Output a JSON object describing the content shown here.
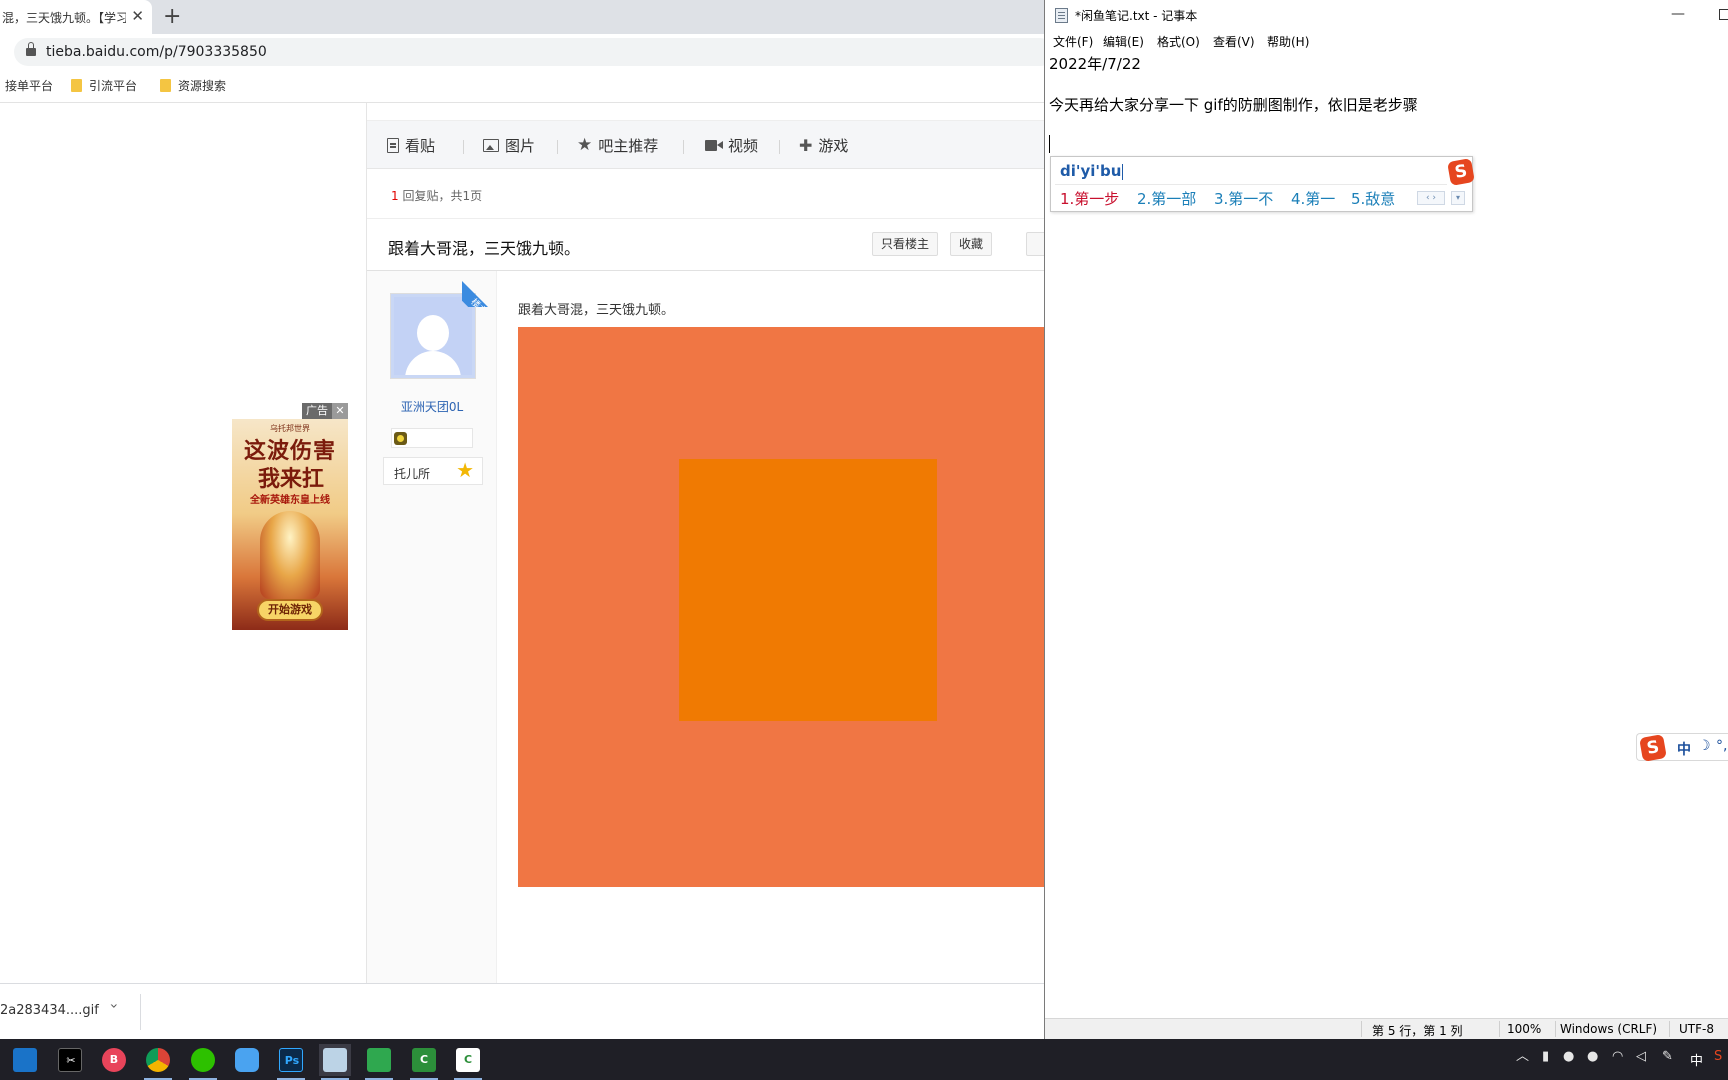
{
  "browser": {
    "tab": {
      "title": "混，三天饿九顿。【学习",
      "close_glyph": "✕"
    },
    "new_tab_glyph": "+",
    "url": "tieba.baidu.com/p/7903335850",
    "bookmarks": [
      {
        "label": "接单平台"
      },
      {
        "label": "引流平台"
      },
      {
        "label": "资源搜索"
      }
    ],
    "nav": {
      "kantie": "看贴",
      "tupian": "图片",
      "bazhu": "吧主推荐",
      "shipin": "视频",
      "youxi": "游戏"
    },
    "reply_count": {
      "num": "1",
      "text": "回复贴，共1页"
    },
    "thread_title": "跟着大哥混，三天饿九顿。",
    "buttons": {
      "only_op": "只看楼主",
      "favorite": "收藏"
    },
    "post": {
      "ribbon": "楼主",
      "author_name": "亚洲天团0L",
      "tag": "托儿所",
      "text": "跟着大哥混，三天饿九顿。",
      "gif_colors": {
        "outer": "#f07644",
        "inner": "#f07a02"
      }
    },
    "ad": {
      "tag": "广告",
      "close": "✕",
      "brand": "乌托邦世界",
      "line1": "这波伤害",
      "line2": "我来扛",
      "sub": "全新英雄东皇上线",
      "button": "开始游戏"
    },
    "download": {
      "filename": "2a283434....gif",
      "chevron": "‹"
    }
  },
  "notepad": {
    "title": "*闲鱼笔记.txt - 记事本",
    "menu": [
      "文件(F)",
      "编辑(E)",
      "格式(O)",
      "查看(V)",
      "帮助(H)"
    ],
    "lines": [
      "2022年/7/22",
      "今天再给大家分享一下  gif的防删图制作，依旧是老步骤"
    ],
    "ime": {
      "input": "di'yi'bu",
      "logo": "S",
      "candidates": [
        "1.第一步",
        "2.第一部",
        "3.第一不",
        "4.第一",
        "5.敌意"
      ],
      "pager": "‹ ›",
      "more": "▾"
    },
    "status": {
      "position": "第 5 行，第 1 列",
      "zoom": "100%",
      "eol": "Windows (CRLF)",
      "encoding": "UTF-8"
    }
  },
  "ime_floating": {
    "logo": "S",
    "lang": "中",
    "moon": "☽",
    "punc": "°,"
  },
  "taskbar": {
    "apps": [
      {
        "name": "mail-icon",
        "text": "",
        "color": "#1a73c8"
      },
      {
        "name": "capcut-icon",
        "text": "✂",
        "color": "#000000"
      },
      {
        "name": "bilibili-icon",
        "text": "B",
        "color": "#e8445a"
      },
      {
        "name": "chrome-icon",
        "text": "",
        "color": "#db4437"
      },
      {
        "name": "wechat-icon",
        "text": "",
        "color": "#2dc100"
      },
      {
        "name": "baidu-netdisk-icon",
        "text": "",
        "color": "#4aa3f0"
      },
      {
        "name": "photoshop-icon",
        "text": "Ps",
        "color": "#0b2a4a"
      },
      {
        "name": "notepad-icon",
        "text": "",
        "color": "#bcd3e6"
      },
      {
        "name": "green-app-icon",
        "text": "",
        "color": "#2fa84f"
      },
      {
        "name": "camtasia-icon",
        "text": "C",
        "color": "#2c8f3a"
      },
      {
        "name": "camtasia-recorder-icon",
        "text": "C",
        "color": "#2c8f3a"
      }
    ],
    "tray_lang": "中"
  }
}
